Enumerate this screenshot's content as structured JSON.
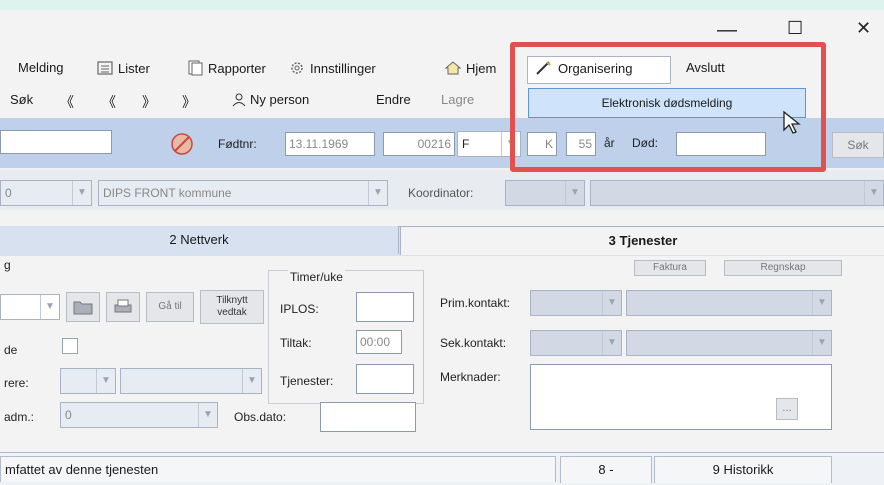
{
  "window": {
    "minimize": "—",
    "maximize": "☐",
    "close": "✕"
  },
  "menu": {
    "melding": "Melding",
    "lister": "Lister",
    "rapporter": "Rapporter",
    "innstillinger": "Innstillinger",
    "hjem": "Hjem",
    "organisering": "Organisering",
    "avslutt": "Avslutt"
  },
  "dropdown": {
    "item1": "Elektronisk dødsmelding"
  },
  "toolbar": {
    "sok": "Søk",
    "first": "《",
    "prev": "《",
    "next": "》",
    "last": "》",
    "ny_person": "Ny person",
    "endre": "Endre",
    "lagre": "Lagre"
  },
  "person": {
    "fodtnr_label": "Fødtnr:",
    "fodtnr_date": "13.11.1969",
    "fodtnr_num": "00216",
    "gender": "F",
    "k": "K",
    "age": "55",
    "ar_label": "år",
    "dod_label": "Død:",
    "sok_button": "Søk"
  },
  "kommune": {
    "code": "0",
    "name": "DIPS FRONT kommune",
    "koordinator_label": "Koordinator:"
  },
  "tabs": {
    "nettverk": "2 Nettverk",
    "tjenester": "3 Tjenester"
  },
  "panel": {
    "g_label": "g",
    "timer_uke": "Timer/uke",
    "iplos": "IPLOS:",
    "tiltak": "Tiltak:",
    "tiltak_value": "00:00",
    "tjenester": "Tjenester:",
    "obs_dato": "Obs.dato:",
    "de_label": "de",
    "rere_label": "rere:",
    "adm_label": "adm.:",
    "adm_value": "0",
    "ga_ti": "Gå til",
    "tilknytt_vedtak": "Tilknytt vedtak",
    "faktura": "Faktura",
    "regnskap": "Regnskap",
    "prim_kontakt": "Prim.kontakt:",
    "sek_kontakt": "Sek.kontakt:",
    "merknader": "Merknader:",
    "ellipsis": "..."
  },
  "bottom": {
    "omfattet": "mfattet av denne tjenesten",
    "tab8": "8 -",
    "tab9": "9 Historikk"
  }
}
